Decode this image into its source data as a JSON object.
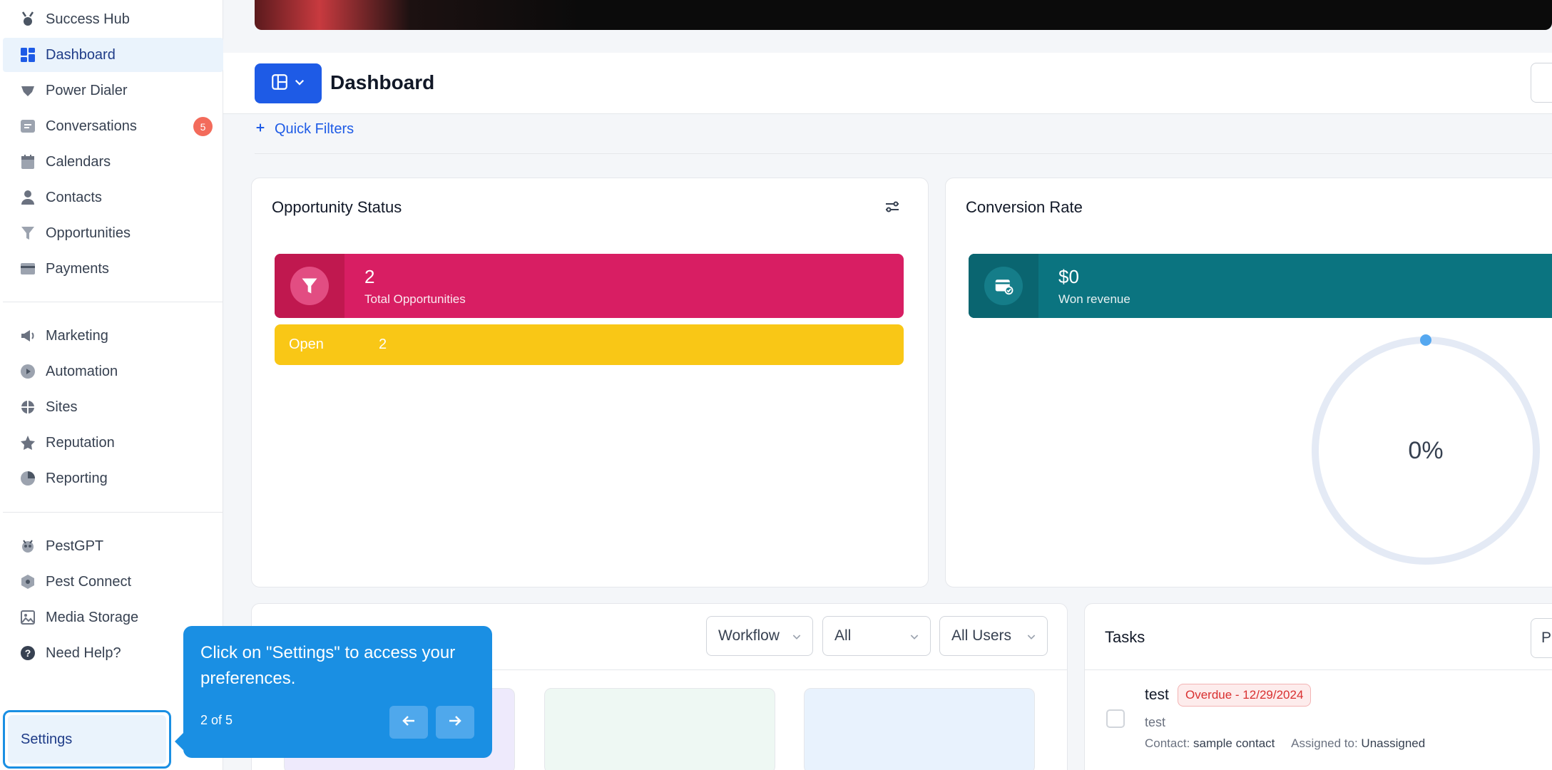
{
  "sidebar": {
    "items": [
      {
        "label": "Success Hub",
        "icon": "medal-icon"
      },
      {
        "label": "Dashboard",
        "icon": "dashboard-icon"
      },
      {
        "label": "Power Dialer",
        "icon": "dialer-icon"
      },
      {
        "label": "Conversations",
        "icon": "chat-icon",
        "badge": "5"
      },
      {
        "label": "Calendars",
        "icon": "calendar-icon"
      },
      {
        "label": "Contacts",
        "icon": "user-icon"
      },
      {
        "label": "Opportunities",
        "icon": "funnel-icon"
      },
      {
        "label": "Payments",
        "icon": "credit-card-icon"
      },
      {
        "label": "Marketing",
        "icon": "megaphone-icon"
      },
      {
        "label": "Automation",
        "icon": "automation-icon"
      },
      {
        "label": "Sites",
        "icon": "sites-icon"
      },
      {
        "label": "Reputation",
        "icon": "star-icon"
      },
      {
        "label": "Reporting",
        "icon": "pie-chart-icon"
      },
      {
        "label": "PestGPT",
        "icon": "pestgpt-icon"
      },
      {
        "label": "Pest Connect",
        "icon": "pest-connect-icon"
      },
      {
        "label": "Media Storage",
        "icon": "image-icon"
      },
      {
        "label": "Need Help?",
        "icon": "help-icon"
      }
    ],
    "settings_label": "Settings"
  },
  "header": {
    "title": "Dashboard",
    "quick_filters": "Quick Filters"
  },
  "opportunity_status": {
    "title": "Opportunity Status",
    "total_value": "2",
    "total_label": "Total Opportunities",
    "open_label": "Open",
    "open_count": "2"
  },
  "conversion_rate": {
    "title": "Conversion Rate",
    "won_value": "$0",
    "won_label": "Won revenue",
    "rate": "0%"
  },
  "workflow_card": {
    "dropdowns": [
      "Workflow",
      "All",
      "All Users"
    ]
  },
  "tasks": {
    "title": "Tasks",
    "right_button": "P",
    "item": {
      "title": "test",
      "overdue": "Overdue - 12/29/2024",
      "description": "test",
      "contact_label": "Contact:",
      "contact_value": "sample contact",
      "assigned_label": "Assigned to:",
      "assigned_value": "Unassigned"
    }
  },
  "tooltip": {
    "text": "Click on \"Settings\" to access your preferences.",
    "step": "2 of 5"
  },
  "colors": {
    "accent": "#1e5be6",
    "tooltip": "#1a8fe3",
    "opportunities": "#d81e63",
    "open": "#f9c716",
    "revenue": "#0b7480",
    "badge": "#f36b5b"
  }
}
